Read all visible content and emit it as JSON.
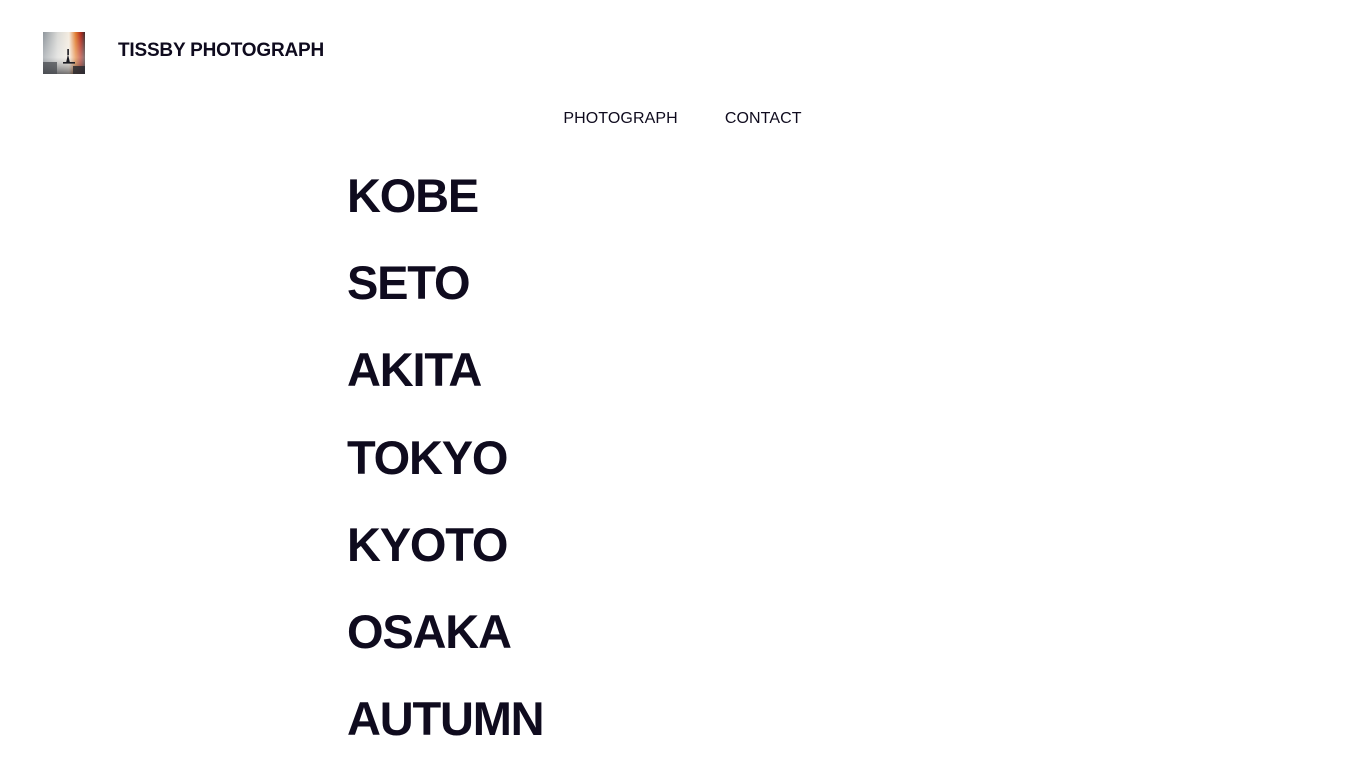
{
  "header": {
    "logo_alt": "Site logo",
    "site_title": "TISSBY PHOTOGRAPH"
  },
  "nav": {
    "items": [
      {
        "label": "PHOTOGRAPH"
      },
      {
        "label": "CONTACT"
      }
    ]
  },
  "albums": [
    {
      "title": "KOBE"
    },
    {
      "title": "SETO"
    },
    {
      "title": "AKITA"
    },
    {
      "title": "TOKYO"
    },
    {
      "title": "KYOTO"
    },
    {
      "title": "OSAKA"
    },
    {
      "title": "AUTUMN"
    }
  ],
  "colors": {
    "text": "#0f0b1e",
    "background": "#ffffff"
  }
}
